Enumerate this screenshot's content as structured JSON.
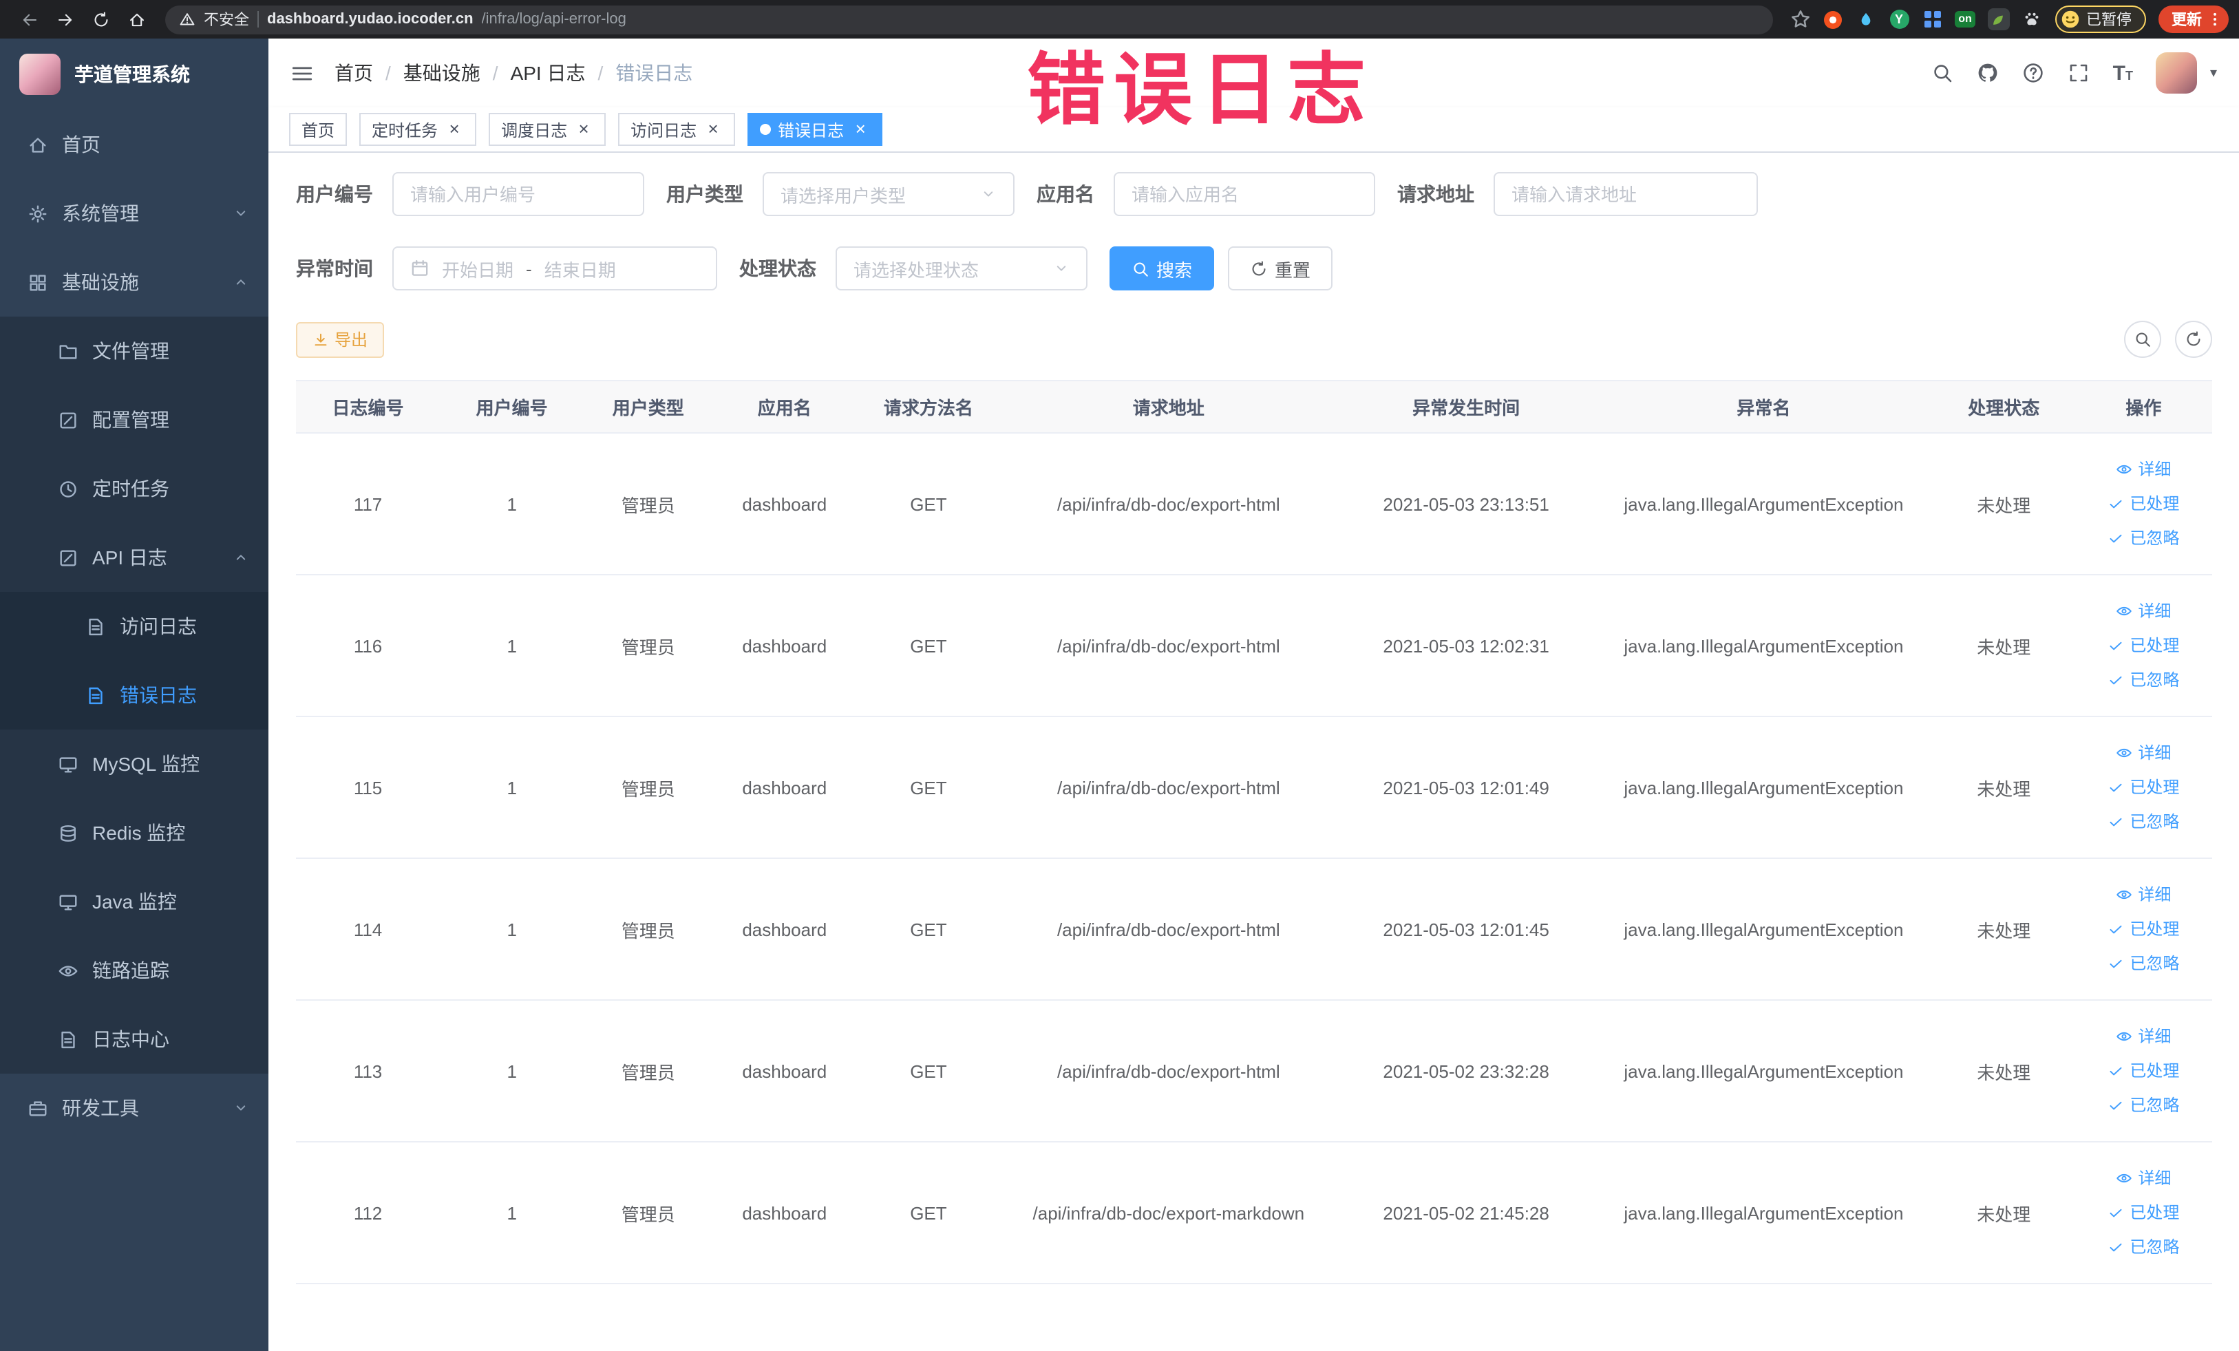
{
  "colors": {
    "primary": "#409EFF",
    "annotation": "#F1335F",
    "sidebar_bg": "#304156",
    "sidebar_submenu_bg": "#1F2D3D",
    "active_tab_bg": "#409EFF",
    "warning_text": "#E6A23C",
    "update_chip_bg": "#E0452C"
  },
  "browser": {
    "security_label": "不安全",
    "url_domain": "dashboard.yudao.iocoder.cn",
    "url_path": "/infra/log/api-error-log",
    "extension_on_badge": "on",
    "extension_y_letter": "Y",
    "profile_paused_label": "已暂停",
    "update_button_label": "更新"
  },
  "sidebar": {
    "logo_title": "芋道管理系统",
    "items": [
      {
        "label": "首页",
        "level": 1,
        "icon": "home"
      },
      {
        "label": "系统管理",
        "level": 1,
        "icon": "gear",
        "chevron": "down"
      },
      {
        "label": "基础设施",
        "level": 1,
        "icon": "grid",
        "chevron": "up"
      },
      {
        "label": "文件管理",
        "level": 2,
        "icon": "folder"
      },
      {
        "label": "配置管理",
        "level": 2,
        "icon": "edit"
      },
      {
        "label": "定时任务",
        "level": 2,
        "icon": "clock"
      },
      {
        "label": "API 日志",
        "level": 2,
        "icon": "apilog",
        "chevron": "up"
      },
      {
        "label": "访问日志",
        "level": 3,
        "icon": "doc"
      },
      {
        "label": "错误日志",
        "level": 3,
        "icon": "doc",
        "active": true
      },
      {
        "label": "MySQL 监控",
        "level": 2,
        "icon": "monitor"
      },
      {
        "label": "Redis 监控",
        "level": 2,
        "icon": "db"
      },
      {
        "label": "Java 监控",
        "level": 2,
        "icon": "java"
      },
      {
        "label": "链路追踪",
        "level": 2,
        "icon": "eye"
      },
      {
        "label": "日志中心",
        "level": 2,
        "icon": "doc2"
      },
      {
        "label": "研发工具",
        "level": 1,
        "icon": "tools",
        "chevron": "down"
      }
    ]
  },
  "header": {
    "breadcrumb": [
      "首页",
      "基础设施",
      "API 日志",
      "错误日志"
    ]
  },
  "annotation": {
    "text": "错误日志"
  },
  "tabs": [
    {
      "label": "首页",
      "closable": false,
      "active": false
    },
    {
      "label": "定时任务",
      "closable": true,
      "active": false
    },
    {
      "label": "调度日志",
      "closable": true,
      "active": false
    },
    {
      "label": "访问日志",
      "closable": true,
      "active": false
    },
    {
      "label": "错误日志",
      "closable": true,
      "active": true
    }
  ],
  "filters": {
    "user_id": {
      "label": "用户编号",
      "placeholder": "请输入用户编号"
    },
    "user_type": {
      "label": "用户类型",
      "placeholder": "请选择用户类型"
    },
    "app_name": {
      "label": "应用名",
      "placeholder": "请输入应用名"
    },
    "request_url": {
      "label": "请求地址",
      "placeholder": "请输入请求地址"
    },
    "exception_time": {
      "label": "异常时间",
      "start_placeholder": "开始日期",
      "separator": "-",
      "end_placeholder": "结束日期"
    },
    "process_status": {
      "label": "处理状态",
      "placeholder": "请选择处理状态"
    },
    "search_label": "搜索",
    "reset_label": "重置"
  },
  "toolbar": {
    "export_label": "导出"
  },
  "table": {
    "columns": [
      "日志编号",
      "用户编号",
      "用户类型",
      "应用名",
      "请求方法名",
      "请求地址",
      "异常发生时间",
      "异常名",
      "处理状态",
      "操作"
    ],
    "action_labels": [
      "详细",
      "已处理",
      "已忽略"
    ],
    "rows": [
      {
        "id": "117",
        "user_id": "1",
        "user_type": "管理员",
        "app": "dashboard",
        "method": "GET",
        "url": "/api/infra/db-doc/export-html",
        "time": "2021-05-03 23:13:51",
        "exception": "java.lang.IllegalArgumentException",
        "status": "未处理"
      },
      {
        "id": "116",
        "user_id": "1",
        "user_type": "管理员",
        "app": "dashboard",
        "method": "GET",
        "url": "/api/infra/db-doc/export-html",
        "time": "2021-05-03 12:02:31",
        "exception": "java.lang.IllegalArgumentException",
        "status": "未处理"
      },
      {
        "id": "115",
        "user_id": "1",
        "user_type": "管理员",
        "app": "dashboard",
        "method": "GET",
        "url": "/api/infra/db-doc/export-html",
        "time": "2021-05-03 12:01:49",
        "exception": "java.lang.IllegalArgumentException",
        "status": "未处理"
      },
      {
        "id": "114",
        "user_id": "1",
        "user_type": "管理员",
        "app": "dashboard",
        "method": "GET",
        "url": "/api/infra/db-doc/export-html",
        "time": "2021-05-03 12:01:45",
        "exception": "java.lang.IllegalArgumentException",
        "status": "未处理"
      },
      {
        "id": "113",
        "user_id": "1",
        "user_type": "管理员",
        "app": "dashboard",
        "method": "GET",
        "url": "/api/infra/db-doc/export-html",
        "time": "2021-05-02 23:32:28",
        "exception": "java.lang.IllegalArgumentException",
        "status": "未处理"
      },
      {
        "id": "112",
        "user_id": "1",
        "user_type": "管理员",
        "app": "dashboard",
        "method": "GET",
        "url": "/api/infra/db-doc/export-markdown",
        "time": "2021-05-02 21:45:28",
        "exception": "java.lang.IllegalArgumentException",
        "status": "未处理"
      }
    ]
  }
}
